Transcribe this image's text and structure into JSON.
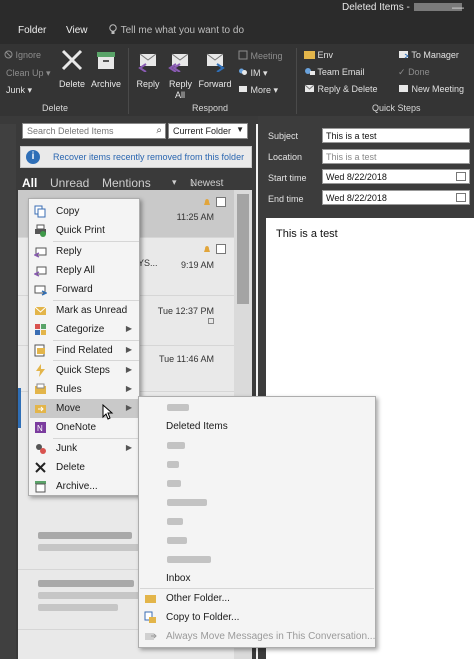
{
  "window": {
    "title": "Deleted Items -",
    "minimize": "—"
  },
  "tabs": [
    "Folder",
    "View"
  ],
  "tell_me": "Tell me what you want to do",
  "ribbon": {
    "delete_group": {
      "label": "Delete",
      "ignore": "Ignore",
      "cleanup": "Clean Up",
      "junk": "Junk",
      "delete": "Delete",
      "archive": "Archive"
    },
    "respond_group": {
      "label": "Respond",
      "reply": "Reply",
      "reply_all": "Reply All",
      "forward": "Forward",
      "meeting": "Meeting",
      "im": "IM",
      "more": "More"
    },
    "quicksteps_group": {
      "label": "Quick Steps",
      "items": [
        "Env",
        "Team Email",
        "Reply & Delete",
        "To Manager",
        "Done",
        "New Meeting"
      ]
    }
  },
  "search": {
    "placeholder": "Search Deleted Items",
    "scope": "Current Folder"
  },
  "recover_link": "Recover items recently removed from this folder",
  "filters": {
    "all": "All",
    "unread": "Unread",
    "mentions": "Mentions",
    "sort": "Newest"
  },
  "messages": [
    {
      "time": "11:25 AM"
    },
    {
      "time": "9:19 AM",
      "snippet": "YS..."
    },
    {
      "time": "Tue 12:37 PM"
    },
    {
      "time": "Tue 11:46 AM"
    }
  ],
  "reading": {
    "subject_label": "Subject",
    "subject": "This is a test",
    "location_label": "Location",
    "location": "This is a test",
    "start_label": "Start time",
    "start": "Wed 8/22/2018",
    "end_label": "End time",
    "end": "Wed 8/22/2018",
    "body": "This is a test"
  },
  "context_menu": [
    {
      "label": "Copy",
      "icon": "copy-icon"
    },
    {
      "label": "Quick Print",
      "icon": "print-icon"
    },
    {
      "label": "Reply",
      "icon": "reply-icon"
    },
    {
      "label": "Reply All",
      "icon": "reply-all-icon"
    },
    {
      "label": "Forward",
      "icon": "forward-icon"
    },
    {
      "label": "Mark as Unread",
      "icon": "envelope-icon"
    },
    {
      "label": "Categorize",
      "icon": "category-icon"
    },
    {
      "label": "Find Related",
      "icon": "find-related-icon"
    },
    {
      "label": "Quick Steps",
      "icon": "lightning-icon"
    },
    {
      "label": "Rules",
      "icon": "rules-icon"
    },
    {
      "label": "Move",
      "icon": "move-folder-icon"
    },
    {
      "label": "OneNote",
      "icon": "onenote-icon"
    },
    {
      "label": "Junk",
      "icon": "junk-icon"
    },
    {
      "label": "Delete",
      "icon": "delete-x-icon"
    },
    {
      "label": "Archive...",
      "icon": "archive-icon"
    }
  ],
  "move_submenu": {
    "deleted_items": "Deleted Items",
    "inbox": "Inbox",
    "other_folder": "Other Folder...",
    "copy_to_folder": "Copy to Folder...",
    "always_move": "Always Move Messages in This Conversation..."
  },
  "colors": {
    "accent": "#2f6fb7",
    "ribbon_bg": "#343434",
    "titlebar_bg": "#2b2b2b"
  }
}
